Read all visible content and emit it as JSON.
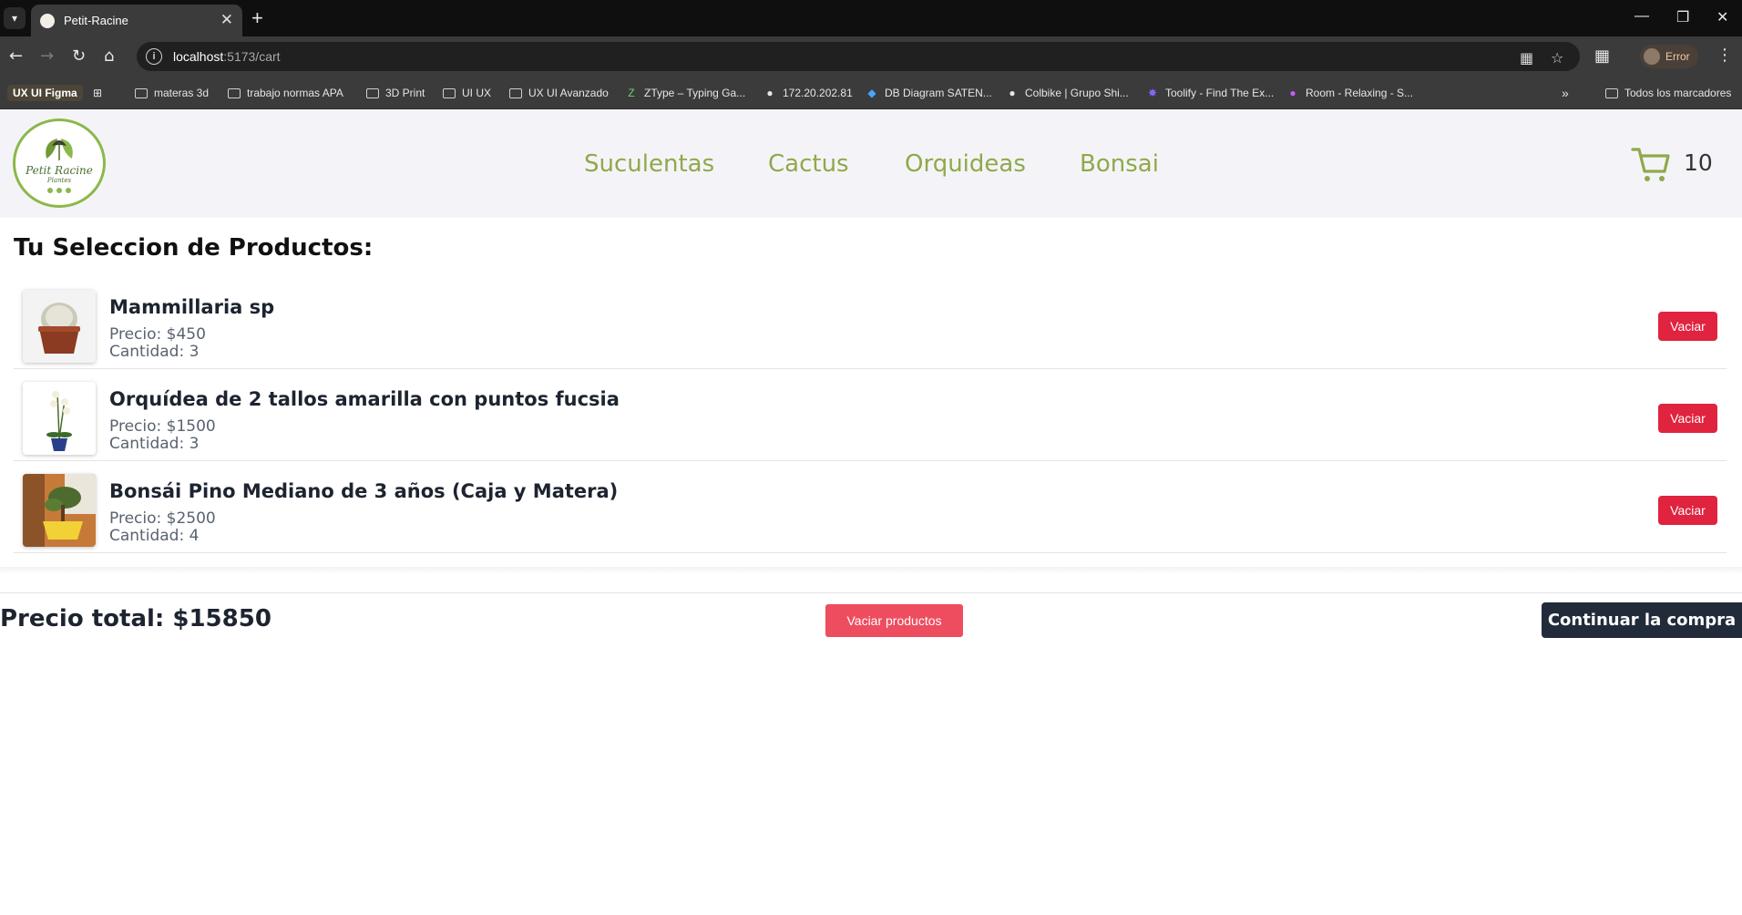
{
  "browser": {
    "tab_title": "Petit-Racine",
    "new_tab_label": "+",
    "url_host": "localhost",
    "url_path": ":5173/cart",
    "profile_label": "Error",
    "bookmarks": [
      "UX UI Figma",
      "materas 3d",
      "trabajo normas APA",
      "3D Print",
      "UI UX",
      "UX UI Avanzado",
      "ZType – Typing Ga...",
      "172.20.202.81",
      "DB Diagram SATEN...",
      "Colbike | Grupo Shi...",
      "Toolify - Find The Ex...",
      "Room - Relaxing - S...",
      "Todos los marcadores"
    ]
  },
  "site": {
    "logo_text": "Petit Racine",
    "logo_sub": "Plantes",
    "nav": [
      "Suculentas",
      "Cactus",
      "Orquideas",
      "Bonsai"
    ],
    "cart_count": "10"
  },
  "cart": {
    "title": "Tu Seleccion de Productos:",
    "items": [
      {
        "name": "Mammillaria sp",
        "price": "Precio: $450",
        "qty": "Cantidad: 3",
        "button": "Vaciar"
      },
      {
        "name": "Orquídea de 2 tallos amarilla con puntos fucsia",
        "price": "Precio: $1500",
        "qty": "Cantidad: 3",
        "button": "Vaciar"
      },
      {
        "name": "Bonsái Pino Mediano de 3 años (Caja y Matera)",
        "price": "Precio: $2500",
        "qty": "Cantidad: 4",
        "button": "Vaciar"
      }
    ],
    "total": "Precio total: $15850",
    "clear_button": "Vaciar productos",
    "continue_button": "Continuar la compra"
  },
  "colors": {
    "brand_green": "#8fa94a",
    "danger": "#e0233e",
    "dark_button": "#222b3a"
  }
}
